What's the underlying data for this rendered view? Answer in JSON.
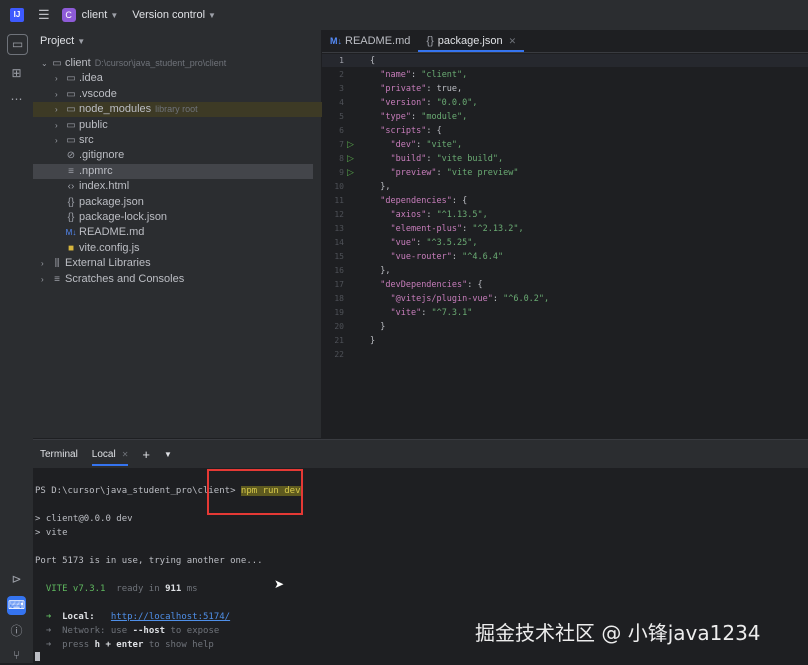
{
  "titlebar": {
    "project_badge": "C",
    "project_name": "client",
    "vcs_label": "Version control"
  },
  "project_panel": {
    "title": "Project",
    "items": [
      {
        "label": "client",
        "hint": "D:\\cursor\\java_student_pro\\client",
        "icon": "folder-icon",
        "depth": 0,
        "open": true
      },
      {
        "label": ".idea",
        "icon": "folder-icon",
        "depth": 1
      },
      {
        "label": ".vscode",
        "icon": "folder-icon",
        "depth": 1
      },
      {
        "label": "node_modules",
        "hint": "library root",
        "icon": "folder-icon",
        "depth": 1
      },
      {
        "label": "public",
        "icon": "folder-icon",
        "depth": 1
      },
      {
        "label": "src",
        "icon": "folder-icon",
        "depth": 1
      },
      {
        "label": ".gitignore",
        "icon": "gitignore-icon",
        "depth": 1
      },
      {
        "label": ".npmrc",
        "icon": "config-file-icon",
        "depth": 1,
        "selected": true
      },
      {
        "label": "index.html",
        "icon": "html-file-icon",
        "depth": 1
      },
      {
        "label": "package.json",
        "icon": "json-file-icon",
        "depth": 1
      },
      {
        "label": "package-lock.json",
        "icon": "json-file-icon",
        "depth": 1
      },
      {
        "label": "README.md",
        "icon": "markdown-file-icon",
        "depth": 1
      },
      {
        "label": "vite.config.js",
        "icon": "js-file-icon",
        "depth": 1
      },
      {
        "label": "External Libraries",
        "icon": "library-icon",
        "depth": 0
      },
      {
        "label": "Scratches and Consoles",
        "icon": "scratches-icon",
        "depth": 0
      }
    ]
  },
  "editor": {
    "tabs": [
      {
        "label": "README.md",
        "badge": "M↓"
      },
      {
        "label": "package.json",
        "badge": "{}",
        "active": true
      }
    ],
    "lines": [
      {
        "n": "1",
        "text": "{"
      },
      {
        "n": "2",
        "text": "  \"name\": \"client\","
      },
      {
        "n": "3",
        "text": "  \"private\": true,"
      },
      {
        "n": "4",
        "text": "  \"version\": \"0.0.0\","
      },
      {
        "n": "5",
        "text": "  \"type\": \"module\","
      },
      {
        "n": "6",
        "text": "  \"scripts\": {"
      },
      {
        "n": "7",
        "text": "    \"dev\": \"vite\",",
        "run": true
      },
      {
        "n": "8",
        "text": "    \"build\": \"vite build\",",
        "run": true
      },
      {
        "n": "9",
        "text": "    \"preview\": \"vite preview\"",
        "run": true
      },
      {
        "n": "10",
        "text": "  },"
      },
      {
        "n": "11",
        "text": "  \"dependencies\": {"
      },
      {
        "n": "12",
        "text": "    \"axios\": \"^1.13.5\","
      },
      {
        "n": "13",
        "text": "    \"element-plus\": \"^2.13.2\","
      },
      {
        "n": "14",
        "text": "    \"vue\": \"^3.5.25\","
      },
      {
        "n": "15",
        "text": "    \"vue-router\": \"^4.6.4\""
      },
      {
        "n": "16",
        "text": "  },"
      },
      {
        "n": "17",
        "text": "  \"devDependencies\": {"
      },
      {
        "n": "18",
        "text": "    \"@vitejs/plugin-vue\": \"^6.0.2\","
      },
      {
        "n": "19",
        "text": "    \"vite\": \"^7.3.1\""
      },
      {
        "n": "20",
        "text": "  }"
      },
      {
        "n": "21",
        "text": "}"
      },
      {
        "n": "22",
        "text": ""
      }
    ]
  },
  "terminal": {
    "tab_title": "Terminal",
    "tab_local": "Local",
    "prompt": "PS D:\\cursor\\java_student_pro\\client>",
    "command": "npm run dev",
    "out1": "> client@0.0.0 dev",
    "out2": "> vite",
    "port_msg": "Port 5173 is in use, trying another one...",
    "vite_name": "VITE v7.3.1",
    "ready_pre": "ready in",
    "ready_ms": "911",
    "ready_unit": "ms",
    "local_label": "Local:",
    "local_url": "http://localhost:5174/",
    "network_label": "Network:",
    "network_use": "use",
    "network_flag": "--host",
    "network_tail": "to expose",
    "press_label": "press",
    "press_key": "h + enter",
    "press_tail": "to show help"
  },
  "watermark": "掘金技术社区 @ 小锋java1234",
  "colors": {
    "accent": "#3574f0",
    "highlight_box": "#e53935",
    "string": "#6aab73",
    "key": "#c77dbb"
  }
}
